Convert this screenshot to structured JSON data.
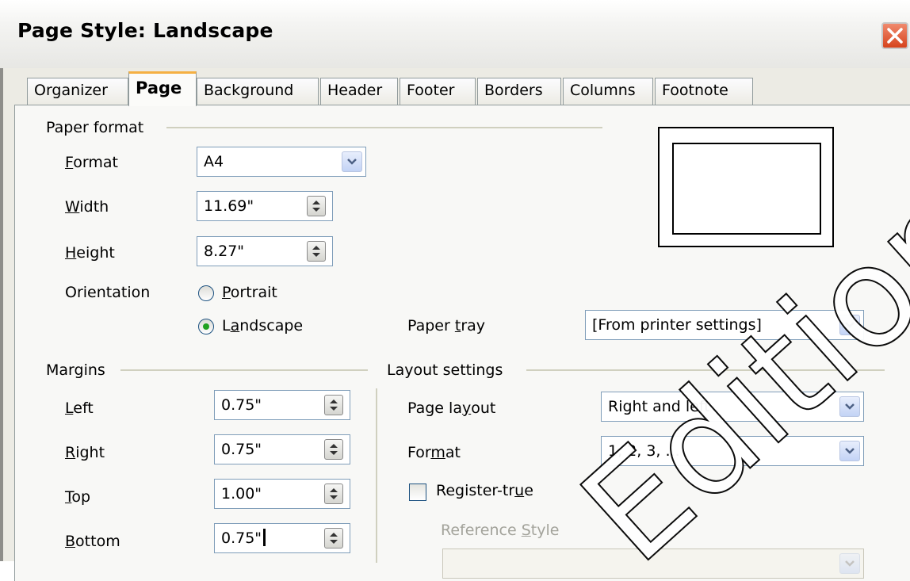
{
  "window": {
    "title": "Page Style: Landscape"
  },
  "tabs": [
    "Organizer",
    "Page",
    "Background",
    "Header",
    "Footer",
    "Borders",
    "Columns",
    "Footnote"
  ],
  "active_tab": "Page",
  "paper_format": {
    "heading": "Paper format",
    "format_label": "Format",
    "format_value": "A4",
    "width_label": "Width",
    "width_value": "11.69\"",
    "height_label": "Height",
    "height_value": "8.27\"",
    "orientation_label": "Orientation",
    "portrait_label": "Portrait",
    "landscape_label": "Landscape",
    "selected_orientation": "Landscape",
    "paper_tray_label": "Paper tray",
    "paper_tray_value": "[From printer settings]"
  },
  "margins": {
    "heading": "Margins",
    "left_label": "Left",
    "left_value": "0.75\"",
    "right_label": "Right",
    "right_value": "0.75\"",
    "top_label": "Top",
    "top_value": "1.00\"",
    "bottom_label": "Bottom",
    "bottom_value": "0.75\""
  },
  "layout": {
    "heading": "Layout settings",
    "page_layout_label": "Page layout",
    "page_layout_value": "Right and left",
    "format_label": "Format",
    "format_value": "1, 2, 3, ...",
    "register_true_label": "Register-true",
    "register_true_checked": false,
    "reference_style_label": "Reference Style"
  },
  "watermark_text": "Edition",
  "colors": {
    "accent_tab": "#f5b042",
    "close_button": "#d6431c",
    "watermark": "#000000"
  }
}
